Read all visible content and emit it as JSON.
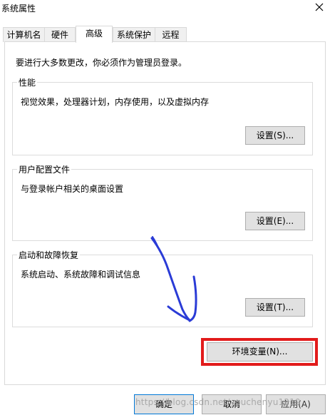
{
  "window": {
    "title": "系统属性"
  },
  "tabs": [
    {
      "label": "计算机名"
    },
    {
      "label": "硬件"
    },
    {
      "label": "高级"
    },
    {
      "label": "系统保护"
    },
    {
      "label": "远程"
    }
  ],
  "admin_note": "要进行大多数更改，你必须作为管理员登录。",
  "groups": {
    "performance": {
      "title": "性能",
      "desc": "视觉效果，处理器计划，内存使用，以及虚拟内存",
      "button": "设置(S)..."
    },
    "user_profiles": {
      "title": "用户配置文件",
      "desc": "与登录帐户相关的桌面设置",
      "button": "设置(E)..."
    },
    "startup_recovery": {
      "title": "启动和故障恢复",
      "desc": "系统启动、系统故障和调试信息",
      "button": "设置(T)..."
    }
  },
  "env_button": "环境变量(N)...",
  "footer": {
    "ok": "确定",
    "cancel": "取消",
    "apply": "应用(A)"
  },
  "watermark": "https://blog.csdn.net/youchenyu1219",
  "annotations": {
    "highlight_color": "#e21b1b",
    "arrow_color": "#2a3bd6"
  }
}
